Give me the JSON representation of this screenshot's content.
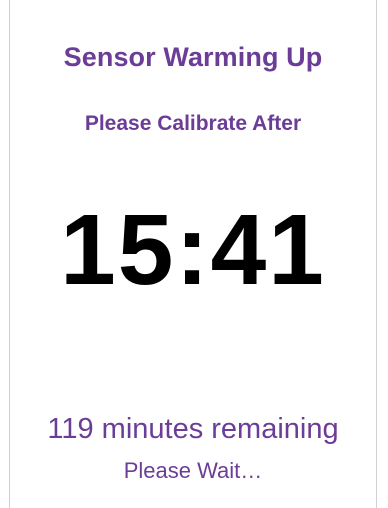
{
  "screen": {
    "title": "Sensor Warming Up",
    "subtitle": "Please Calibrate After",
    "time": "15:41",
    "remaining": "119 minutes remaining",
    "wait": "Please Wait…"
  },
  "colors": {
    "accent": "#6b3d97",
    "time": "#000000",
    "background": "#ffffff"
  }
}
